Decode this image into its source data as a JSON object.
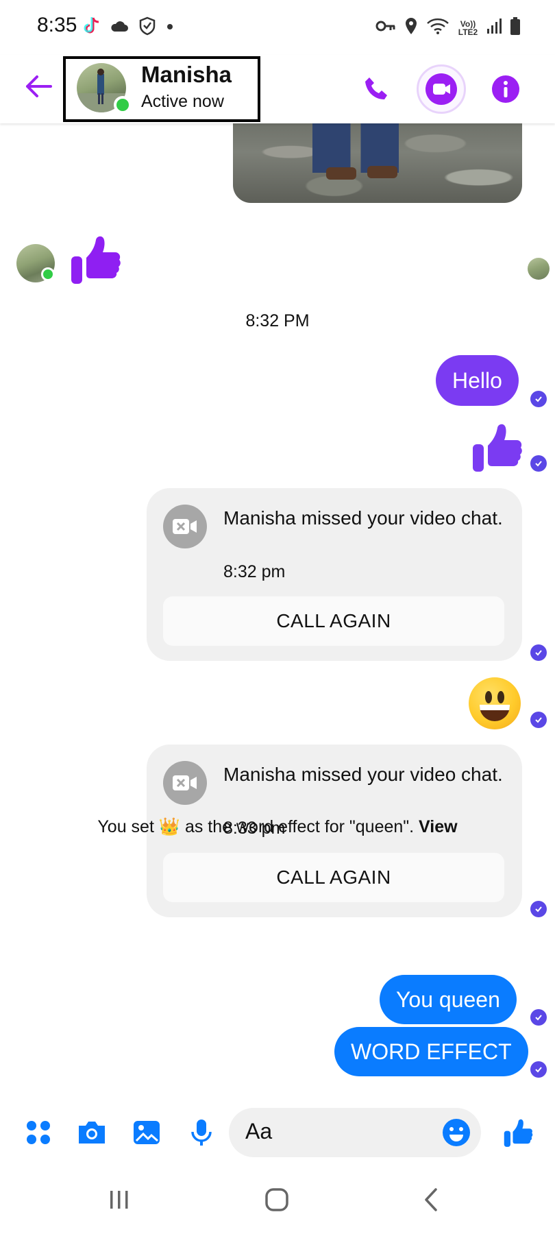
{
  "status_bar": {
    "time": "8:35",
    "left_icons": [
      "tiktok-icon",
      "cloud-icon",
      "shield-icon",
      "dot-icon"
    ],
    "right_icons": [
      "key-icon",
      "location-icon",
      "wifi-icon",
      "volte-icon",
      "signal-icon",
      "battery-icon"
    ],
    "volte_label": "Vo))\nLTE2"
  },
  "header": {
    "contact_name": "Manisha",
    "contact_status": "Active now",
    "accent_color": "#9b1ff3"
  },
  "messages": {
    "timestamp": "8:32 PM",
    "hello": "Hello",
    "missed_call_1": {
      "text": "Manisha missed your video chat.",
      "time": "8:32 pm",
      "button": "CALL AGAIN"
    },
    "missed_call_2": {
      "text": "Manisha missed your video chat.",
      "time": "8:33 pm",
      "button": "CALL AGAIN"
    },
    "effect_note": {
      "prefix": "You set ",
      "emoji": "👑",
      "suffix": " as the word effect for \"queen\". ",
      "link": "View"
    },
    "you_queen": "You queen",
    "word_effect": "WORD EFFECT"
  },
  "composer": {
    "placeholder": "Aa",
    "icons": [
      "apps-icon",
      "camera-icon",
      "gallery-icon",
      "microphone-icon",
      "emoji-icon",
      "like-icon"
    ]
  },
  "navbar": {
    "icons": [
      "recents-icon",
      "home-icon",
      "back-icon"
    ]
  },
  "colors": {
    "purple_bubble": "#7b3bf2",
    "blue_bubble": "#0a7cff",
    "messenger_blue": "#0a7cff",
    "seen_check": "#5a47e6",
    "online_green": "#31cc46"
  }
}
